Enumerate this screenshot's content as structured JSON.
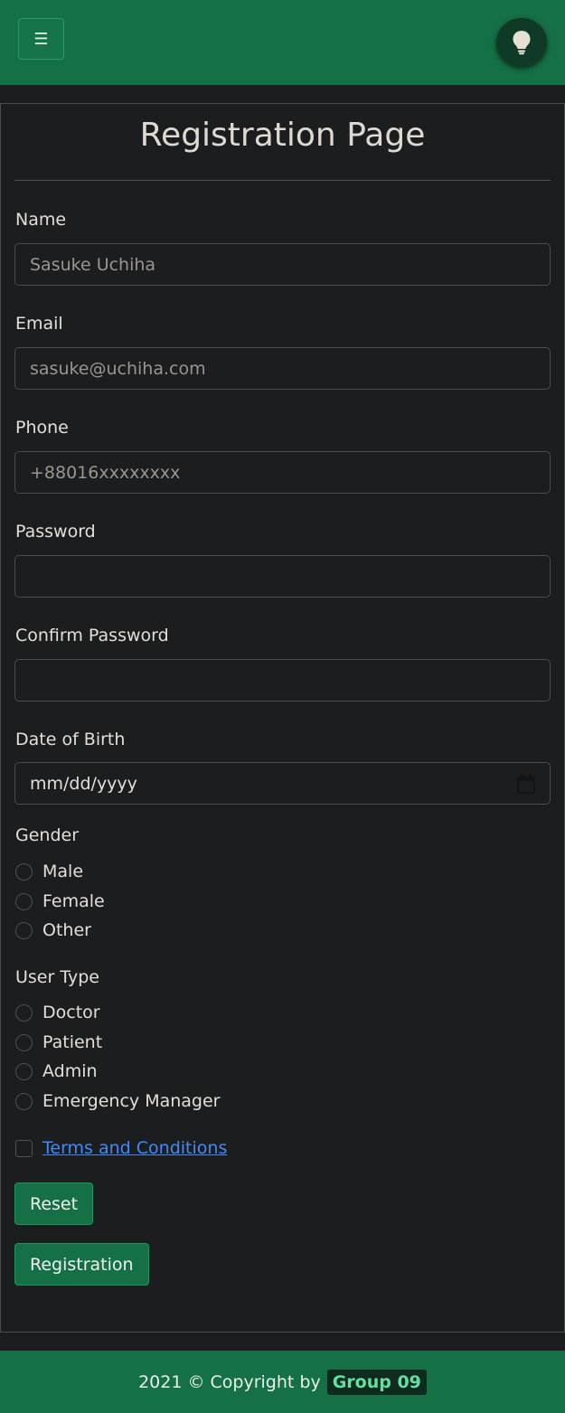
{
  "navbar": {
    "menu_icon": "☰",
    "theme_toggle_icon": "lightbulb-icon"
  },
  "form": {
    "title": "Registration Page",
    "name_label": "Name",
    "name_placeholder": "Sasuke Uchiha",
    "email_label": "Email",
    "email_placeholder": "sasuke@uchiha.com",
    "phone_label": "Phone",
    "phone_placeholder": "+88016xxxxxxxx",
    "password_label": "Password",
    "confirm_password_label": "Confirm Password",
    "dob_label": "Date of Birth",
    "dob_placeholder": "mm/dd/yyyy",
    "gender_label": "Gender",
    "gender_options": [
      "Male",
      "Female",
      "Other"
    ],
    "user_type_label": "User Type",
    "user_type_options": [
      "Doctor",
      "Patient",
      "Admin",
      "Emergency Manager"
    ],
    "terms_label": "Terms and Conditions",
    "reset_label": "Reset",
    "register_label": "Registration"
  },
  "footer": {
    "copyright": "2021 © Copyright by",
    "group": "Group 09"
  },
  "colors": {
    "brand_green": "#157045",
    "background": "#1c1d1f",
    "link_blue": "#3d8bfd"
  }
}
